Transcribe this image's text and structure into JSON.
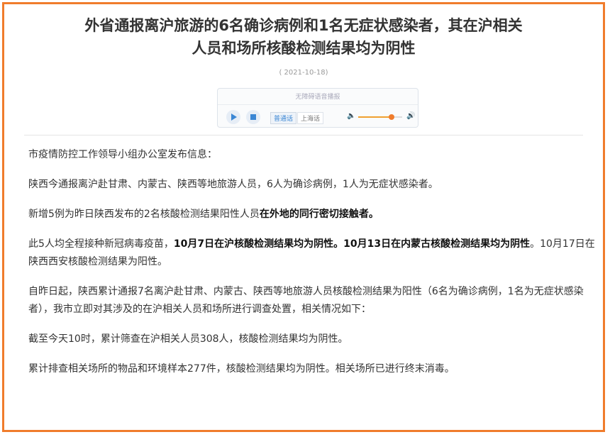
{
  "article": {
    "title_line1": "外省通报离沪旅游的6名确诊病例和1名无症状感染者，其在沪相关",
    "title_line2": "人员和场所核酸检测结果均为阴性",
    "date": "( 2021-10-18)"
  },
  "player": {
    "heading": "无障碍语音播报",
    "lang_active": "普通话",
    "lang_other": "上海话",
    "volume_level": 0.75,
    "accent_color": "#3a86d4",
    "volume_color": "#f07c2c"
  },
  "paragraphs": {
    "p1": "市疫情防控工作领导小组办公室发布信息：",
    "p2": "陕西今通报离沪赴甘肃、内蒙古、陕西等地旅游人员，6人为确诊病例，1人为无症状感染者。",
    "p3a": "新增5例为昨日陕西发布的2名核酸检测结果阳性人员",
    "p3b": "在外地的同行密切接触者。",
    "p4a": "此5人均全程接种新冠病毒疫苗，",
    "p4b": "10月7日在沪核酸检测结果均为阴性。10月13日在内蒙古核酸检测结果均为阴性",
    "p4c": "。10月17日在陕西西安核酸检测结果为阳性。",
    "p5": "自昨日起，陕西累计通报7名离沪赴甘肃、内蒙古、陕西等地旅游人员核酸检测结果为阳性（6名为确诊病例，1名为无症状感染者），我市立即对其涉及的在沪相关人员和场所进行调查处置，相关情况如下：",
    "p6": "截至今天10时，累计筛查在沪相关人员308人，核酸检测结果均为阴性。",
    "p7": "累计排查相关场所的物品和环境样本277件，核酸检测结果均为阴性。相关场所已进行终末消毒。"
  },
  "frame_color": "#f07c2c"
}
